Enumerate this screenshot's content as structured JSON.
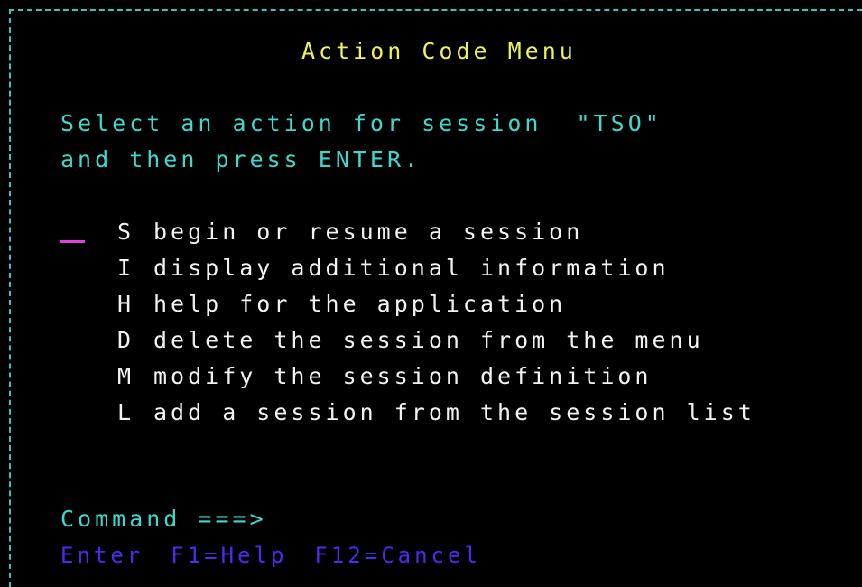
{
  "title": "Action Code Menu",
  "prompt": {
    "line1": "Select an action for session  \"TSO\"",
    "line2": "and then press ENTER."
  },
  "options": [
    {
      "code": "S",
      "text": "begin or resume a session"
    },
    {
      "code": "I",
      "text": "display additional information"
    },
    {
      "code": "H",
      "text": "help for the application"
    },
    {
      "code": "D",
      "text": "delete the session from the menu"
    },
    {
      "code": "M",
      "text": "modify the session definition"
    },
    {
      "code": "L",
      "text": "add a session from the session list"
    }
  ],
  "command": {
    "label": "Command ===>",
    "value": ""
  },
  "function_keys": {
    "enter": "Enter",
    "help": "F1=Help",
    "cancel": "F12=Cancel"
  },
  "colors": {
    "background": "#000000",
    "border": "#34c6c6",
    "title": "#f0f058",
    "prompt": "#3fd8cf",
    "options": "#f2f2f2",
    "function_keys": "#4a2bf0",
    "input_cursor": "#e040e0"
  }
}
